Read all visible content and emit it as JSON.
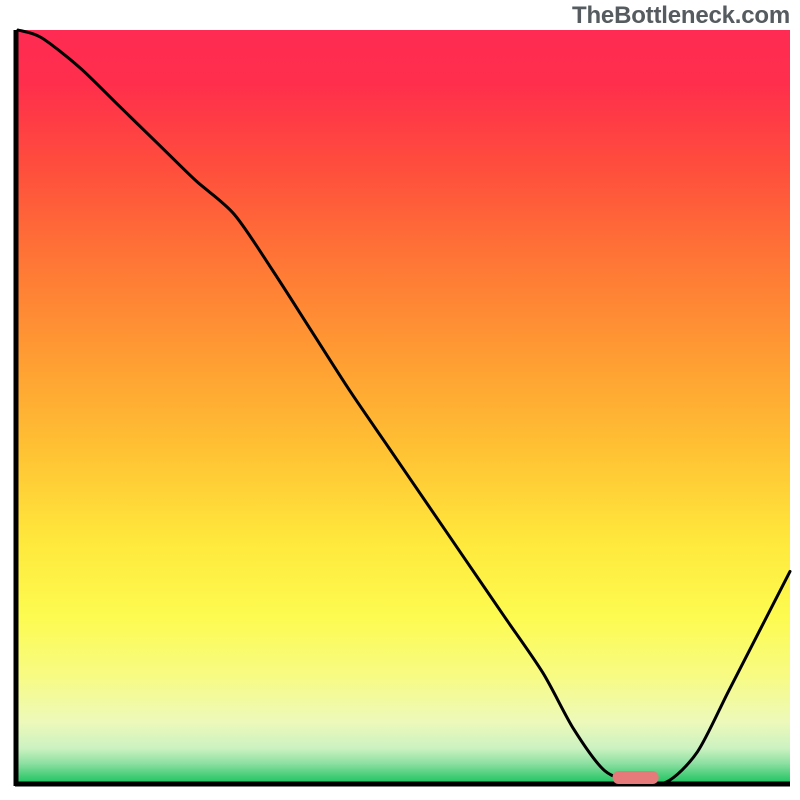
{
  "watermark": "TheBottleneck.com",
  "chart_data": {
    "type": "line",
    "title": "",
    "xlabel": "",
    "ylabel": "",
    "xlim": [
      0,
      100
    ],
    "ylim": [
      0,
      100
    ],
    "x": [
      0,
      3,
      8,
      13,
      18,
      23,
      28,
      33,
      38,
      43,
      48,
      53,
      58,
      63,
      68,
      72,
      76,
      80,
      84,
      88,
      92,
      96,
      100
    ],
    "values": [
      100,
      99,
      95,
      90,
      85,
      80,
      75.5,
      68,
      60,
      52,
      44.5,
      37,
      29.5,
      22,
      14.5,
      7,
      1.5,
      0,
      0,
      4,
      12,
      20,
      28
    ],
    "series": [
      {
        "name": "bottleneck-curve",
        "x": [
          0,
          3,
          8,
          13,
          18,
          23,
          28,
          33,
          38,
          43,
          48,
          53,
          58,
          63,
          68,
          72,
          76,
          80,
          84,
          88,
          92,
          96,
          100
        ],
        "values": [
          100,
          99,
          95,
          90,
          85,
          80,
          75.5,
          68,
          60,
          52,
          44.5,
          37,
          29.5,
          22,
          14.5,
          7,
          1.5,
          0,
          0,
          4,
          12,
          20,
          28
        ]
      }
    ],
    "annotations": [
      {
        "name": "optimal-zone-marker",
        "x": 80,
        "y": 0,
        "color": "#e67a7a"
      }
    ],
    "background": {
      "type": "vertical-gradient",
      "stops": [
        {
          "pos": 0.0,
          "color": "#ff2b53"
        },
        {
          "pos": 0.07,
          "color": "#ff2e4c"
        },
        {
          "pos": 0.18,
          "color": "#ff4d3d"
        },
        {
          "pos": 0.3,
          "color": "#ff7436"
        },
        {
          "pos": 0.42,
          "color": "#ff9833"
        },
        {
          "pos": 0.55,
          "color": "#ffbf33"
        },
        {
          "pos": 0.68,
          "color": "#ffe83c"
        },
        {
          "pos": 0.78,
          "color": "#fdfb50"
        },
        {
          "pos": 0.86,
          "color": "#f7fb84"
        },
        {
          "pos": 0.92,
          "color": "#edf9ba"
        },
        {
          "pos": 0.955,
          "color": "#ccf2c1"
        },
        {
          "pos": 0.975,
          "color": "#8ee0a2"
        },
        {
          "pos": 0.99,
          "color": "#4ecf7c"
        },
        {
          "pos": 1.0,
          "color": "#24c564"
        }
      ]
    },
    "grid": false,
    "legend": false
  }
}
